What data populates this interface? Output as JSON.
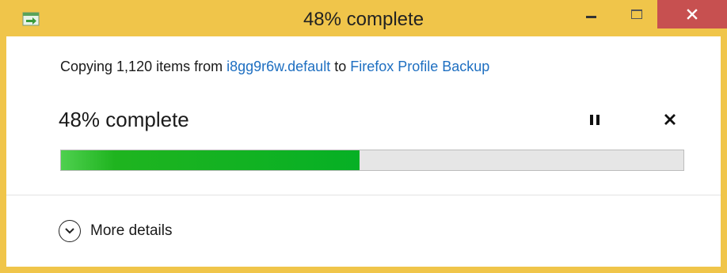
{
  "window": {
    "title": "48% complete",
    "icons": {
      "app": "copy-files-icon",
      "minimize": "minimize-icon",
      "maximize": "maximize-icon",
      "close": "close-icon"
    },
    "colors": {
      "frame": "#f0c54a",
      "close_button": "#c75050"
    }
  },
  "copy": {
    "prefix": "Copying 1,120 items from ",
    "source": "i8gg9r6w.default",
    "connector": " to ",
    "destination": "Firefox Profile Backup",
    "link_color": "#1e6fc1"
  },
  "progress": {
    "percent_text": "48% complete",
    "value": 0.48,
    "fill_color": "#06b025",
    "pause_icon": "pause-icon",
    "stop_icon": "close-icon"
  },
  "details": {
    "label": "More details",
    "icon": "chevron-down-circle-icon"
  }
}
